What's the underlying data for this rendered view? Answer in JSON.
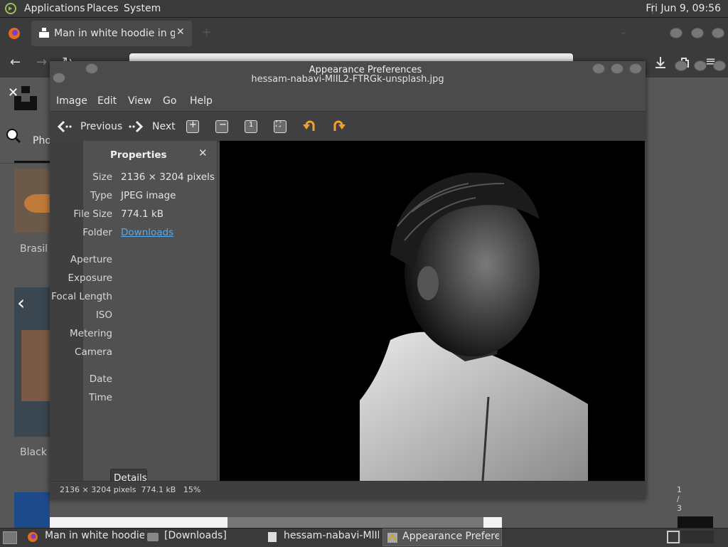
{
  "top_panel": {
    "menus": [
      "Applications",
      "Places",
      "System"
    ],
    "clock": "Fri Jun  9, 09:56"
  },
  "firefox": {
    "tab_title": "Man in white hoodie in grayscale",
    "left_labels": [
      "Pho",
      "Brasil",
      "Black"
    ]
  },
  "appearance_window": {
    "title": "Appearance Preferences"
  },
  "viewer": {
    "filename": "hessam-nabavi-MlIL2-FTRGk-unsplash.jpg",
    "menus": [
      "Image",
      "Edit",
      "View",
      "Go",
      "Help"
    ],
    "toolbar": {
      "previous_label": "Previous",
      "next_label": "Next"
    },
    "properties": {
      "title": "Properties",
      "size_key": "Size",
      "size_val": "2136 × 3204 pixels",
      "type_key": "Type",
      "type_val": "JPEG image",
      "filesize_key": "File Size",
      "filesize_val": "774.1 kB",
      "folder_key": "Folder",
      "folder_val": "Downloads",
      "aperture_key": "Aperture",
      "exposure_key": "Exposure",
      "focal_key": "Focal Length",
      "iso_key": "ISO",
      "metering_key": "Metering",
      "camera_key": "Camera",
      "date_key": "Date",
      "time_key": "Time",
      "details_button": "Details"
    },
    "status": {
      "info": "2136 × 3204 pixels  774.1 kB   15%",
      "position": "1 / 3"
    }
  },
  "taskbar": {
    "items": [
      "Man in white hoodie...",
      "[Downloads]",
      "hessam-nabavi-MlIl...",
      "Appearance Prefere..."
    ]
  },
  "colors": {
    "link": "#5aa9e6",
    "arrow_orange": "#f0a030"
  }
}
